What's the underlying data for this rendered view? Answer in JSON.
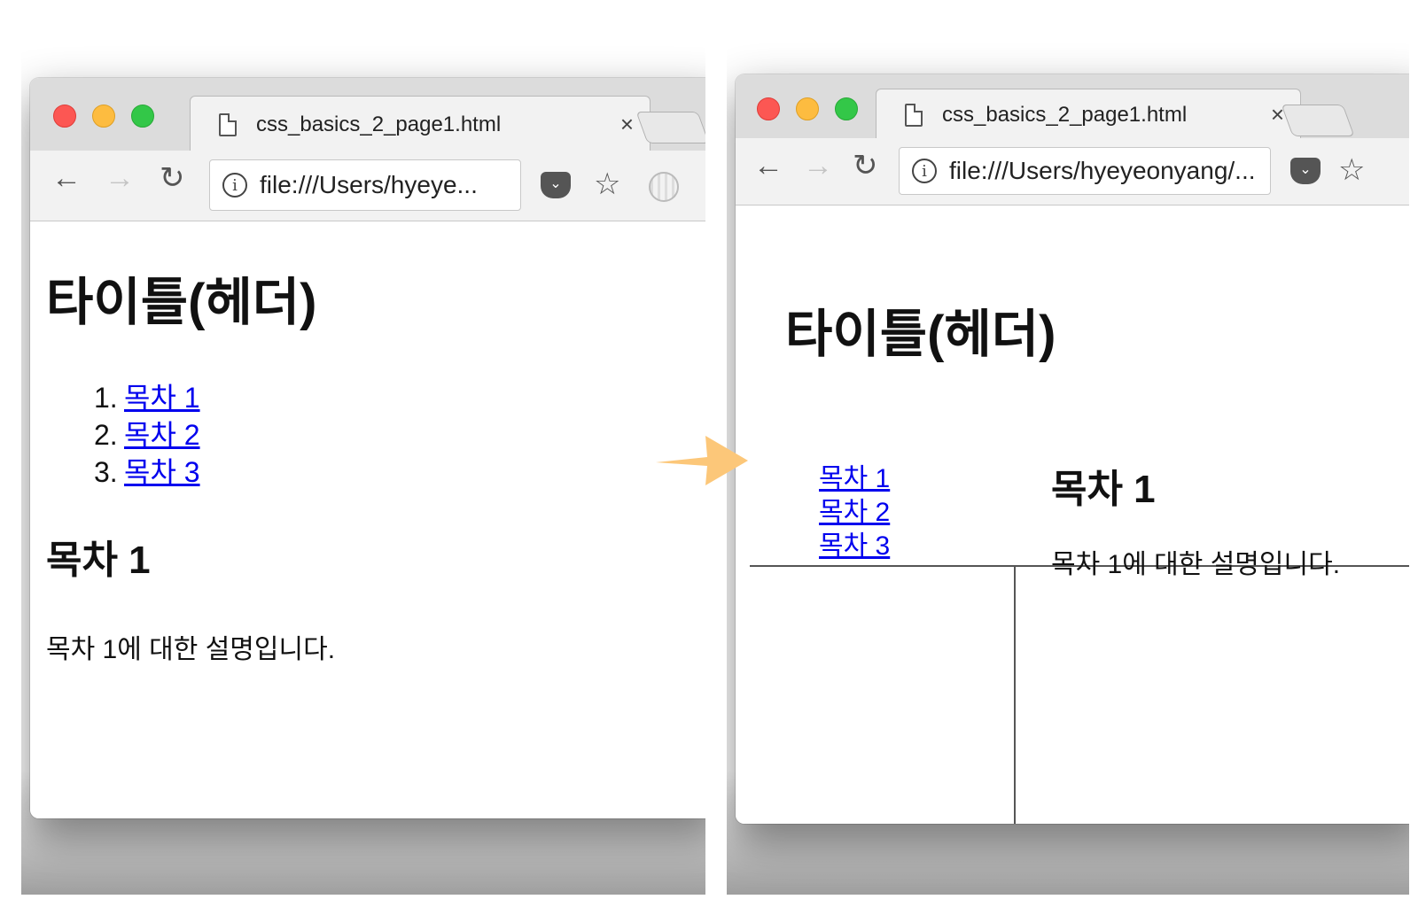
{
  "left_window": {
    "tab_title": "css_basics_2_page1.html",
    "tab_close": "×",
    "url": "file:///Users/hyeye...",
    "page": {
      "title": "타이틀(헤더)",
      "toc": [
        {
          "num": "1.",
          "label": "목차 1"
        },
        {
          "num": "2.",
          "label": "목차 2"
        },
        {
          "num": "3.",
          "label": "목차 3"
        }
      ],
      "section_heading": "목차 1",
      "section_text": "목차 1에 대한 설명입니다."
    }
  },
  "right_window": {
    "tab_title": "css_basics_2_page1.html",
    "tab_close": "×",
    "url": "file:///Users/hyeyeonyang/...",
    "page": {
      "title": "타이틀(헤더)",
      "nav_links": [
        "목차 1",
        "목차 2",
        "목차 3"
      ],
      "section_heading": "목차 1",
      "section_text": "목차 1에 대한 설명입니다."
    }
  },
  "icons": {
    "back": "←",
    "forward": "→",
    "reload": "↻",
    "info": "i",
    "star": "☆",
    "pocket": "⌄"
  },
  "colors": {
    "link": "#0000ee",
    "arrow": "#fcc779",
    "traffic_red": "#fc5753",
    "traffic_yellow": "#fdbc40",
    "traffic_green": "#33c748"
  }
}
